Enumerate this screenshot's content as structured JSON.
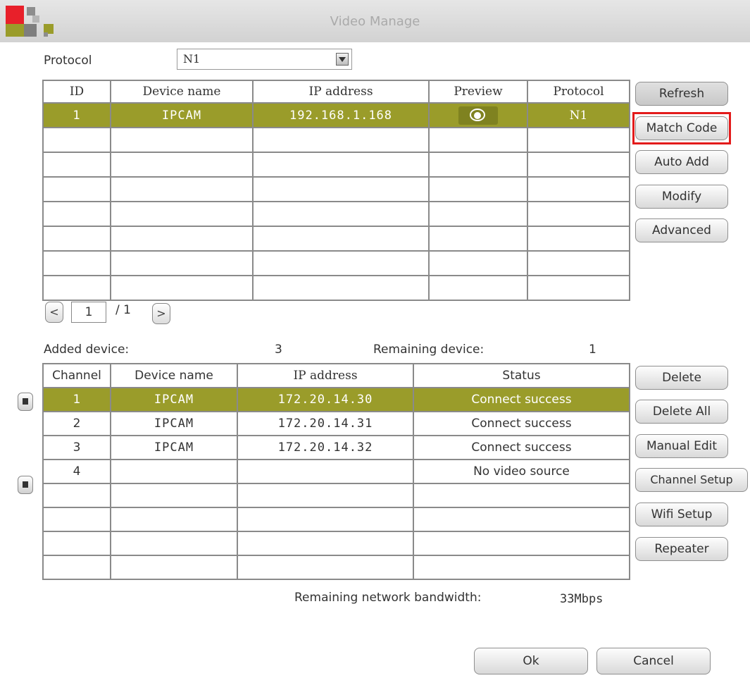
{
  "window": {
    "title": "Video Manage"
  },
  "protocol": {
    "label": "Protocol",
    "selected": "N1"
  },
  "devices_table": {
    "headers": [
      "ID",
      "Device name",
      "IP address",
      "Preview",
      "Protocol"
    ],
    "row": {
      "id": "1",
      "name": "IPCAM",
      "ip": "192.168.1.168",
      "protocol": "N1"
    }
  },
  "pager": {
    "current": "1",
    "total": "/ 1"
  },
  "right_buttons": {
    "refresh": "Refresh",
    "match_code": "Match Code",
    "auto_add": "Auto Add",
    "modify": "Modify",
    "advanced": "Advanced"
  },
  "summary": {
    "added_label": "Added device:",
    "added_value": "3",
    "remaining_label": "Remaining device:",
    "remaining_value": "1"
  },
  "channels_table": {
    "headers": [
      "Channel",
      "Device name",
      "IP address",
      "Status"
    ],
    "rows": [
      {
        "channel": "1",
        "name": "IPCAM",
        "ip": "172.20.14.30",
        "status": "Connect success"
      },
      {
        "channel": "2",
        "name": "IPCAM",
        "ip": "172.20.14.31",
        "status": "Connect success"
      },
      {
        "channel": "3",
        "name": "IPCAM",
        "ip": "172.20.14.32",
        "status": "Connect success"
      },
      {
        "channel": "4",
        "name": "",
        "ip": "",
        "status": "No video source"
      }
    ]
  },
  "lower_buttons": {
    "delete": "Delete",
    "delete_all": "Delete All",
    "manual_edit": "Manual Edit",
    "channel_setup": "Channel Setup",
    "wifi_setup": "Wifi Setup",
    "repeater": "Repeater"
  },
  "bandwidth": {
    "label": "Remaining network bandwidth:",
    "value": "33Mbps"
  },
  "footer": {
    "ok": "Ok",
    "cancel": "Cancel"
  },
  "colors": {
    "selected_row": "#9a9c2a",
    "highlight": "#e31b1b",
    "logo_red": "#e8202a",
    "logo_olive": "#9a9c2a"
  }
}
